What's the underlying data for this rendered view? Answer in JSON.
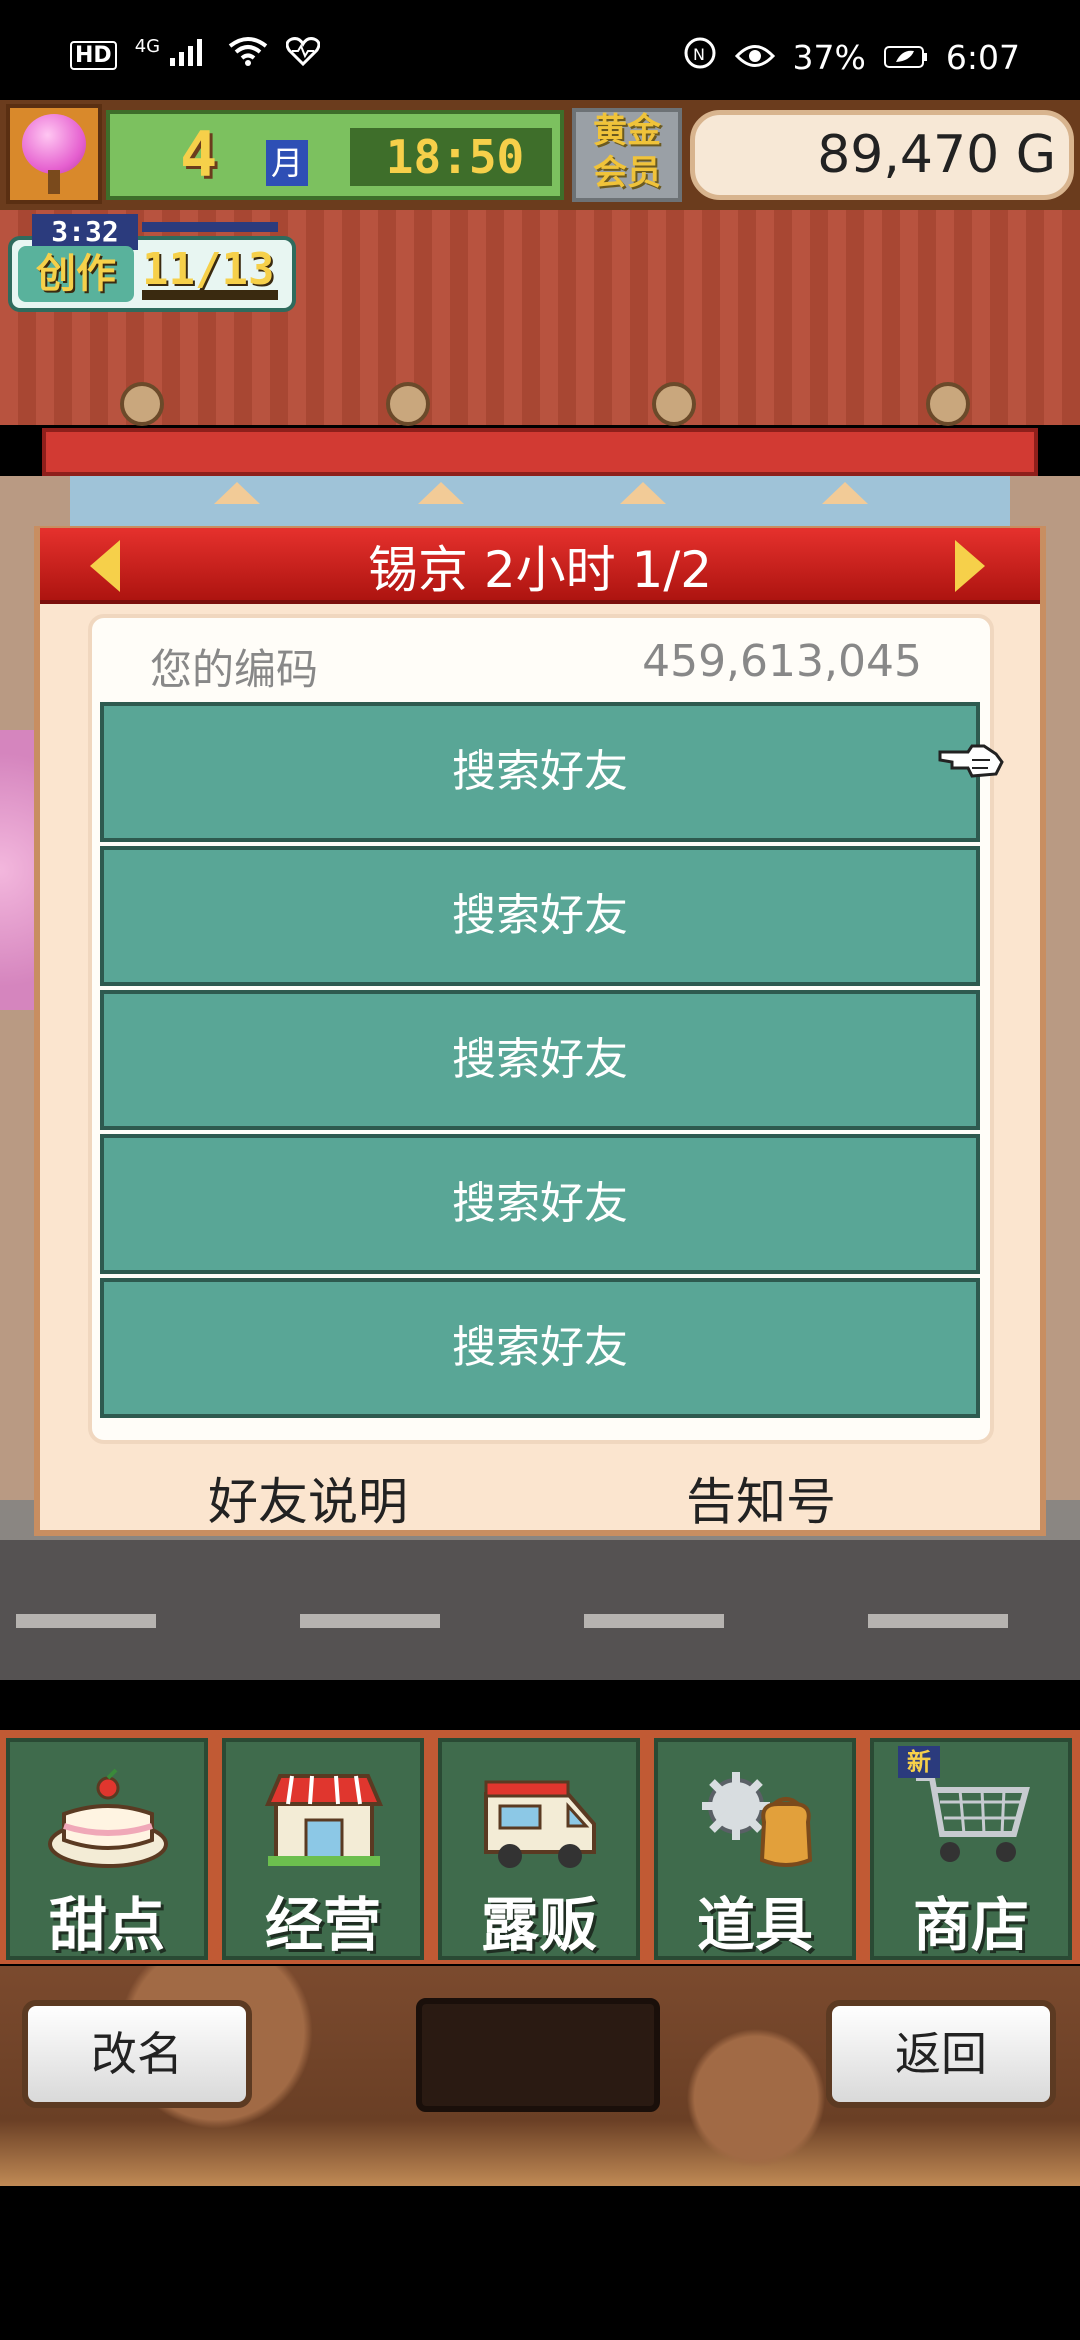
{
  "status_bar": {
    "left_icons": [
      "hd-icon",
      "signal-4g-icon",
      "wifi-icon",
      "heart-icon"
    ],
    "hd": "HD",
    "net": "4G",
    "right_icons": [
      "nfc-icon",
      "eye-icon",
      "battery-icon"
    ],
    "battery": "37%",
    "time": "6:07"
  },
  "hud": {
    "month_number": "4",
    "month_unit": "月",
    "clock": "18:50",
    "membership": "黄金会员",
    "money": "89,470 G"
  },
  "create_badge": {
    "timer": "3:32",
    "title": "创作",
    "count": "11/13"
  },
  "dialog": {
    "title": "锡京  2小时 1/2",
    "code_label": "您的编码",
    "code_value": "459,613,045",
    "friend_buttons": [
      "搜索好友",
      "搜索好友",
      "搜索好友",
      "搜索好友",
      "搜索好友"
    ],
    "link_left": "好友说明",
    "link_right": "告知号"
  },
  "menu": {
    "items": [
      {
        "label": "甜点",
        "icon": "cake-icon"
      },
      {
        "label": "经营",
        "icon": "shop-icon"
      },
      {
        "label": "露贩",
        "icon": "food-truck-icon"
      },
      {
        "label": "道具",
        "icon": "gear-bag-icon"
      },
      {
        "label": "商店",
        "icon": "cart-icon"
      }
    ],
    "new_tag": "新"
  },
  "controls": {
    "rename": "改名",
    "back": "返回"
  },
  "colors": {
    "teal_button": "#59a696",
    "header_red": "#d23a33",
    "gold": "#f6d04a",
    "menu_green": "#3f6b4c"
  }
}
